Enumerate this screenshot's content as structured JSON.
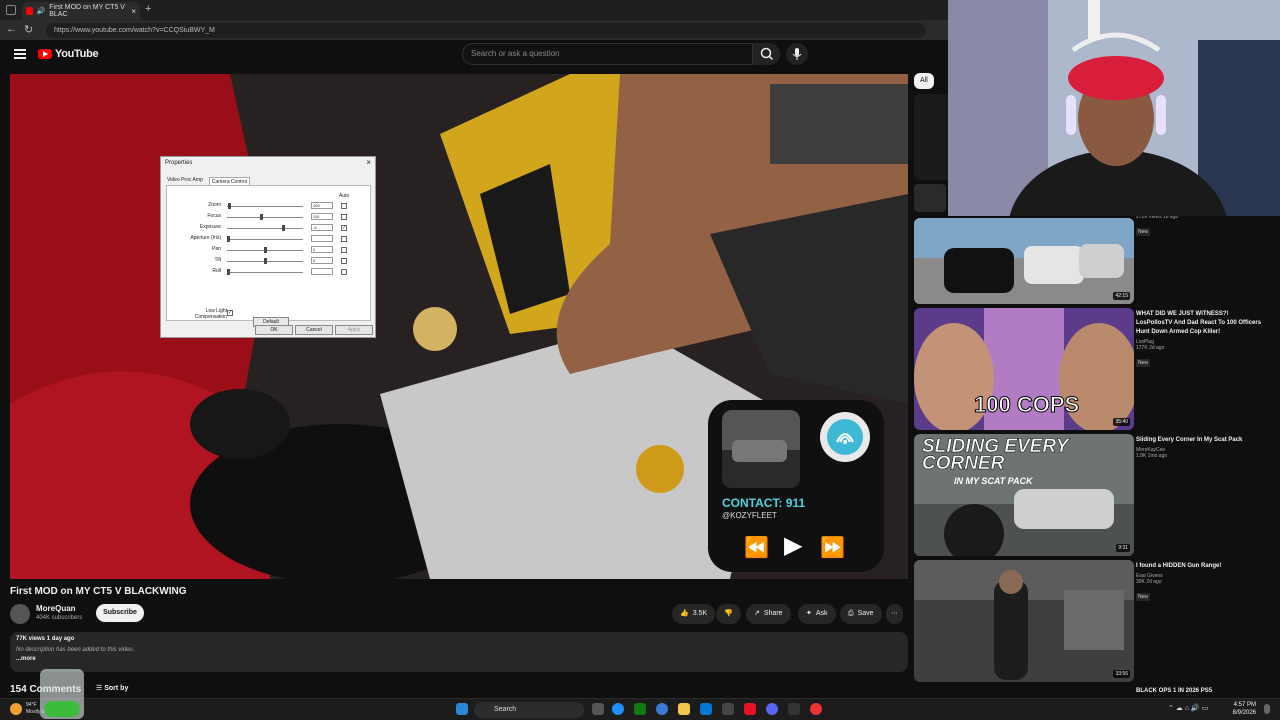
{
  "browser": {
    "tab_title": "First MOD on MY CT5 V BLAC",
    "tab_close": "×",
    "new_tab": "+",
    "url": "https://www.youtube.com/watch?v=CCQSiuBWY_M",
    "back": "←",
    "reload": "↻"
  },
  "yt": {
    "logo": "YouTube",
    "search_placeholder": "Search or ask a question"
  },
  "props_dialog": {
    "title": "Properties",
    "close": "×",
    "tabs": [
      "Video Proc Amp",
      "Camera Control"
    ],
    "auto_label": "Auto",
    "rows": [
      {
        "label": "Zoom",
        "value": "100",
        "checked": "",
        "level": 0.02
      },
      {
        "label": "Focus",
        "value": "110",
        "checked": "",
        "level": 0.45
      },
      {
        "label": "Exposure",
        "value": "-4",
        "checked": "✓",
        "level": 0.75
      },
      {
        "label": "Aperture (Iris)",
        "value": "",
        "checked": "",
        "level": 0.0
      },
      {
        "label": "Pan",
        "value": "0",
        "checked": "",
        "level": 0.5
      },
      {
        "label": "Tilt",
        "value": "0",
        "checked": "",
        "level": 0.5
      },
      {
        "label": "Roll",
        "value": "",
        "checked": "",
        "level": 0.0
      }
    ],
    "low_light": "Low Light Compensation",
    "low_light_check": "✓",
    "default_btn": "Default",
    "ok": "OK",
    "cancel": "Cancel",
    "apply": "Apply"
  },
  "widget": {
    "contact": "CONTACT: 911",
    "handle": "@KOZYFLEET",
    "prev": "⏪",
    "play": "▶",
    "next": "⏩"
  },
  "video": {
    "title": "First MOD on MY CT5 V BLACKWING",
    "channel": "MoreQuan",
    "subscribers": "404K subscribers",
    "subscribe": "Subscribe",
    "likes": "3.5K",
    "share": "Share",
    "ask": "Ask",
    "save": "Save",
    "more": "⋯",
    "meta": "77K views  1 day ago",
    "no_desc": "No description has been added to this video.",
    "more_link": "...more",
    "comments": "154 Comments",
    "sort_by": "Sort by"
  },
  "sidebar": {
    "chip_all": "All",
    "items": [
      {
        "title": "",
        "channel": "",
        "meta": "271K views  1d ago",
        "badge": "New",
        "duration": "42:15"
      },
      {
        "title": "WHAT DID WE JUST WITNESS?! LosPollosTV And Dad React To 100 Officers Hunt Down Armed Cop Killer!",
        "channel": "LosPlug",
        "meta": "177K  2d ago",
        "badge": "New",
        "duration": "35:40",
        "overlay": "100 COPS"
      },
      {
        "title": "Sliding Every Corner In My Scat Pack",
        "channel": "MoreKayCee",
        "meta": "1.8K  1mo ago",
        "badge": "",
        "duration": "9:31",
        "overlay": "SLIDING EVERY CORNER",
        "overlay2": "IN MY SCAT PACK"
      },
      {
        "title": "I found a HIDDEN Gun Range!",
        "channel": "Esai Givens",
        "meta": "30K  2d ago",
        "badge": "New",
        "duration": "33:56"
      },
      {
        "title": "BLACK OPS 1 IN 2026 PS5",
        "channel": "",
        "meta": "",
        "badge": "",
        "duration": ""
      }
    ]
  },
  "taskbar": {
    "weather_temp": "94°F",
    "weather_desc": "Mostly sunny",
    "search": "Search",
    "time": "4:57 PM",
    "date": "8/9/2026"
  },
  "colors": {
    "yt_red": "#ff0000",
    "accent_cyan": "#4fd1e0",
    "bg": "#0f0f0f"
  }
}
